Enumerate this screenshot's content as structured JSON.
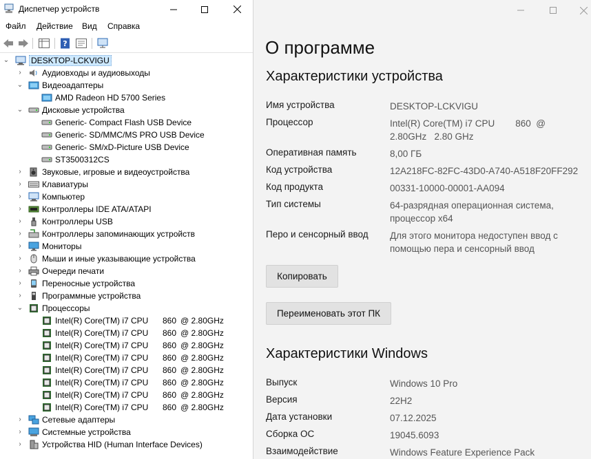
{
  "device_manager": {
    "title": "Диспетчер устройств",
    "menu": [
      "Файл",
      "Действие",
      "Вид",
      "Справка"
    ],
    "tree": {
      "root": "DESKTOP-LCKVIGU",
      "categories": [
        {
          "label": "Аудиовходы и аудиовыходы",
          "icon": "audio-icon",
          "expanded": false,
          "children": []
        },
        {
          "label": "Видеоадаптеры",
          "icon": "display-adapter-icon",
          "expanded": true,
          "children": [
            {
              "label": "AMD Radeon HD 5700 Series",
              "icon": "display-adapter-icon"
            }
          ]
        },
        {
          "label": "Дисковые устройства",
          "icon": "disk-icon",
          "expanded": true,
          "children": [
            {
              "label": "Generic- Compact Flash USB Device",
              "icon": "disk-icon"
            },
            {
              "label": "Generic- SD/MMC/MS PRO USB Device",
              "icon": "disk-icon"
            },
            {
              "label": "Generic- SM/xD-Picture USB Device",
              "icon": "disk-icon"
            },
            {
              "label": "ST3500312CS",
              "icon": "disk-icon"
            }
          ]
        },
        {
          "label": "Звуковые, игровые и видеоустройства",
          "icon": "speaker-icon",
          "expanded": false,
          "children": []
        },
        {
          "label": "Клавиатуры",
          "icon": "keyboard-icon",
          "expanded": false,
          "children": []
        },
        {
          "label": "Компьютер",
          "icon": "computer-icon",
          "expanded": false,
          "children": []
        },
        {
          "label": "Контроллеры IDE ATA/ATAPI",
          "icon": "ide-controller-icon",
          "expanded": false,
          "children": []
        },
        {
          "label": "Контроллеры USB",
          "icon": "usb-icon",
          "expanded": false,
          "children": []
        },
        {
          "label": "Контроллеры запоминающих устройств",
          "icon": "storage-controller-icon",
          "expanded": false,
          "children": []
        },
        {
          "label": "Мониторы",
          "icon": "monitor-icon",
          "expanded": false,
          "children": []
        },
        {
          "label": "Мыши и иные указывающие устройства",
          "icon": "mouse-icon",
          "expanded": false,
          "children": []
        },
        {
          "label": "Очереди печати",
          "icon": "printer-icon",
          "expanded": false,
          "children": []
        },
        {
          "label": "Переносные устройства",
          "icon": "portable-device-icon",
          "expanded": false,
          "children": []
        },
        {
          "label": "Программные устройства",
          "icon": "software-device-icon",
          "expanded": false,
          "children": []
        },
        {
          "label": "Процессоры",
          "icon": "processor-icon",
          "expanded": true,
          "children": [
            {
              "label": "Intel(R) Core(TM) i7 CPU",
              "model": "860",
              "freq": "@ 2.80GHz",
              "icon": "processor-icon"
            },
            {
              "label": "Intel(R) Core(TM) i7 CPU",
              "model": "860",
              "freq": "@ 2.80GHz",
              "icon": "processor-icon"
            },
            {
              "label": "Intel(R) Core(TM) i7 CPU",
              "model": "860",
              "freq": "@ 2.80GHz",
              "icon": "processor-icon"
            },
            {
              "label": "Intel(R) Core(TM) i7 CPU",
              "model": "860",
              "freq": "@ 2.80GHz",
              "icon": "processor-icon"
            },
            {
              "label": "Intel(R) Core(TM) i7 CPU",
              "model": "860",
              "freq": "@ 2.80GHz",
              "icon": "processor-icon"
            },
            {
              "label": "Intel(R) Core(TM) i7 CPU",
              "model": "860",
              "freq": "@ 2.80GHz",
              "icon": "processor-icon"
            },
            {
              "label": "Intel(R) Core(TM) i7 CPU",
              "model": "860",
              "freq": "@ 2.80GHz",
              "icon": "processor-icon"
            },
            {
              "label": "Intel(R) Core(TM) i7 CPU",
              "model": "860",
              "freq": "@ 2.80GHz",
              "icon": "processor-icon"
            }
          ]
        },
        {
          "label": "Сетевые адаптеры",
          "icon": "network-adapter-icon",
          "expanded": false,
          "children": []
        },
        {
          "label": "Системные устройства",
          "icon": "system-device-icon",
          "expanded": false,
          "children": []
        },
        {
          "label": "Устройства HID (Human Interface Devices)",
          "icon": "hid-icon",
          "expanded": false,
          "children": []
        }
      ]
    }
  },
  "settings": {
    "page_title": "О программе",
    "device_specs": {
      "title": "Характеристики устройства",
      "rows": [
        {
          "label": "Имя устройства",
          "value": [
            "DESKTOP-LCKVIGU"
          ]
        },
        {
          "label": "Процессор",
          "value": [
            "Intel(R) Core(TM) i7 CPU        860  @",
            "2.80GHz   2.80 GHz"
          ]
        },
        {
          "label": "Оперативная память",
          "value": [
            "8,00 ГБ"
          ]
        },
        {
          "label": "Код устройства",
          "value": [
            "12A218FC-82FC-43D0-A740-A518F20FF292"
          ]
        },
        {
          "label": "Код продукта",
          "value": [
            "00331-10000-00001-AA094"
          ]
        },
        {
          "label": "Тип системы",
          "value": [
            "64-разрядная операционная система,",
            "процессор x64"
          ]
        },
        {
          "label": "Перо и сенсорный ввод",
          "value": [
            "Для этого монитора недоступен ввод с",
            "помощью пера и сенсорный ввод"
          ]
        }
      ],
      "copy_button": "Копировать",
      "rename_button": "Переименовать этот ПК"
    },
    "windows_specs": {
      "title": "Характеристики Windows",
      "rows": [
        {
          "label": "Выпуск",
          "value": [
            "Windows 10 Pro"
          ]
        },
        {
          "label": "Версия",
          "value": [
            "22H2"
          ]
        },
        {
          "label": "Дата установки",
          "value": [
            "07.12.2025"
          ]
        },
        {
          "label": "Сборка ОС",
          "value": [
            "19045.6093"
          ]
        },
        {
          "label": "Взаимодействие",
          "value": [
            "Windows Feature Experience Pack"
          ]
        }
      ]
    }
  },
  "colors": {
    "accent": "#0067c0",
    "selection": "#cce8ff",
    "settings_bg": "#f3f3f3",
    "button_bg": "#e2e2e2"
  }
}
